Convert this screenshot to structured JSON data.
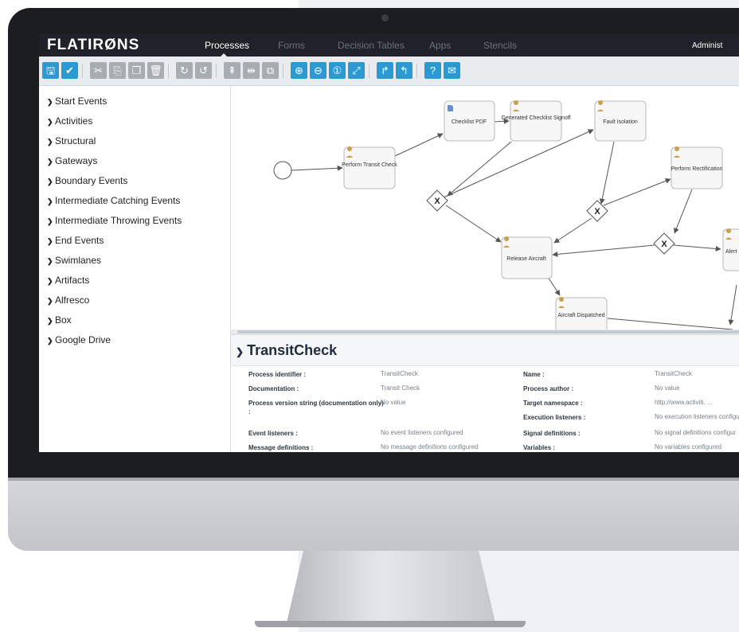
{
  "nav": {
    "logo": "FLATIRØNS",
    "tabs": [
      {
        "label": "Processes",
        "active": true
      },
      {
        "label": "Forms",
        "active": false
      },
      {
        "label": "Decision Tables",
        "active": false
      },
      {
        "label": "Apps",
        "active": false
      },
      {
        "label": "Stencils",
        "active": false
      }
    ],
    "user": "Administ"
  },
  "toolbar": {
    "buttons": [
      {
        "icon": "save-icon",
        "glyph": "🖫"
      },
      {
        "icon": "validate-icon",
        "glyph": "✔"
      },
      {
        "icon": "cut-icon",
        "glyph": "✂"
      },
      {
        "icon": "copy-icon",
        "glyph": "⎘"
      },
      {
        "icon": "paste-icon",
        "glyph": "❐"
      },
      {
        "icon": "delete-icon",
        "glyph": "🗑"
      },
      {
        "icon": "redo-icon",
        "glyph": "↻"
      },
      {
        "icon": "undo-icon",
        "glyph": "↺"
      },
      {
        "icon": "align-vertical-icon",
        "glyph": "⇞"
      },
      {
        "icon": "align-horizontal-icon",
        "glyph": "⇹"
      },
      {
        "icon": "same-size-icon",
        "glyph": "⧉"
      },
      {
        "icon": "zoom-in-icon",
        "glyph": "⊕"
      },
      {
        "icon": "zoom-out-icon",
        "glyph": "⊖"
      },
      {
        "icon": "zoom-actual-icon",
        "glyph": "①"
      },
      {
        "icon": "zoom-fit-icon",
        "glyph": "⤢"
      },
      {
        "icon": "bendpoint-add-icon",
        "glyph": "↱"
      },
      {
        "icon": "bendpoint-remove-icon",
        "glyph": "↰"
      },
      {
        "icon": "help-icon",
        "glyph": "?"
      },
      {
        "icon": "feedback-icon",
        "glyph": "✉"
      }
    ]
  },
  "palette": {
    "items": [
      "Start Events",
      "Activities",
      "Structural",
      "Gateways",
      "Boundary Events",
      "Intermediate Catching Events",
      "Intermediate Throwing Events",
      "End Events",
      "Swimlanes",
      "Artifacts",
      "Alfresco",
      "Box",
      "Google Drive"
    ]
  },
  "diagram": {
    "tasks": {
      "perform_transit_check": "Perform Transit Check",
      "checklist_pdf": "Checklist PDF",
      "generated_checklist_signoff": "Generated Checklist Signoff",
      "fault_isolation": "Fault Isolation",
      "perform_rectification": "Perform Rectification",
      "release_aircraft": "Release Aircraft",
      "aircraft_dispatched": "Aircraft Dispatched",
      "alert": "Alert"
    },
    "gateway_symbol": "X"
  },
  "properties": {
    "title": "TransitCheck",
    "rows": [
      {
        "k1": "Process identifier :",
        "v1": "TransitCheck",
        "k2": "Name :",
        "v2": "TransitCheck"
      },
      {
        "k1": "Documentation :",
        "v1": "Transit Check",
        "k2": "Process author :",
        "v2": "No value"
      },
      {
        "k1": "Process version string (documentation only) :",
        "v1": "No value",
        "k2": "Target namespace :",
        "v2": "http://www.activiti. ..."
      },
      {
        "k1": "",
        "v1": "",
        "k2": "Execution listeners :",
        "v2": "No execution listeners configu"
      },
      {
        "k1": "Event listeners :",
        "v1": "No event listeners configured",
        "k2": "Signal definitions :",
        "v2": "No signal definitions configur"
      },
      {
        "k1": "Message definitions :",
        "v1": "No message definitions configured",
        "k2": "Variables :",
        "v2": "No variables configured"
      }
    ]
  }
}
